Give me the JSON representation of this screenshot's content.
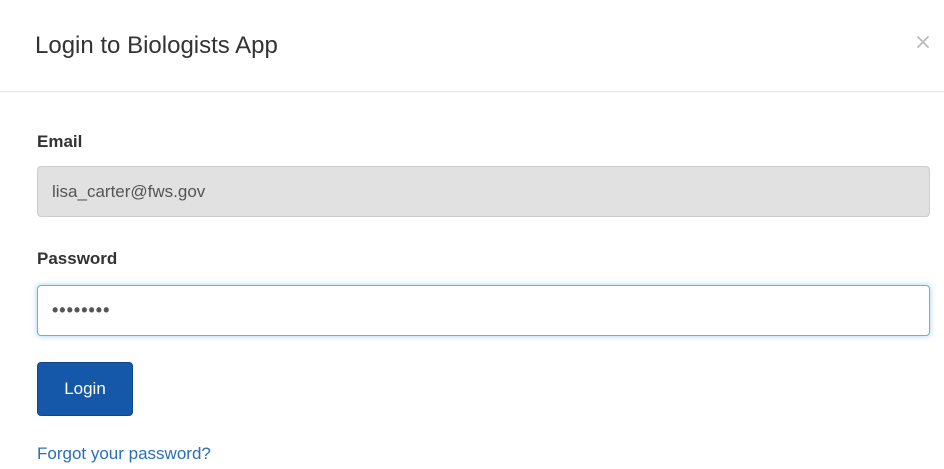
{
  "dialog": {
    "title": "Login to Biologists App",
    "close_label": "×"
  },
  "form": {
    "email": {
      "label": "Email",
      "value": "lisa_carter@fws.gov"
    },
    "password": {
      "label": "Password",
      "value": "••••••••"
    },
    "login_label": "Login",
    "forgot_link": "Forgot your password?"
  },
  "colors": {
    "primary_button": "#1557a8",
    "link": "#2a6fb6",
    "focus_border": "#66afe9",
    "disabled_input_bg": "#e1e1e1"
  },
  "icons": {
    "close": "close-icon"
  }
}
